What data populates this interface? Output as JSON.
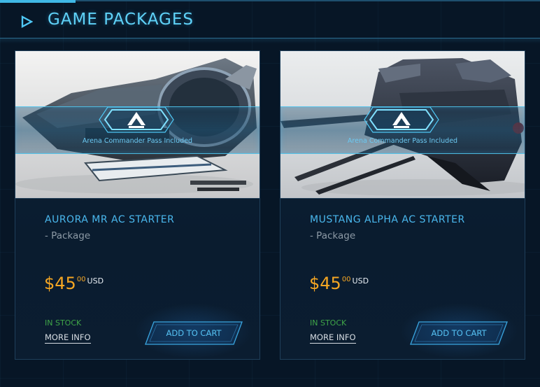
{
  "header": {
    "title": "GAME PACKAGES",
    "icon": "play-icon"
  },
  "colors": {
    "accent": "#5fd2f8",
    "price": "#f5a623",
    "in_stock": "#3fa648"
  },
  "products": [
    {
      "banner_text": "Arena Commander Pass Included",
      "name": "AURORA MR AC STARTER",
      "type": "- Package",
      "price_main": "$45",
      "price_cents": "00",
      "currency": "USD",
      "stock": "IN STOCK",
      "more_info": "MORE INFO",
      "add_to_cart": "ADD TO CART"
    },
    {
      "banner_text": "Arena Commander Pass Included",
      "name": "MUSTANG ALPHA AC STARTER",
      "type": "- Package",
      "price_main": "$45",
      "price_cents": "00",
      "currency": "USD",
      "stock": "IN STOCK",
      "more_info": "MORE INFO",
      "add_to_cart": "ADD TO CART"
    }
  ]
}
